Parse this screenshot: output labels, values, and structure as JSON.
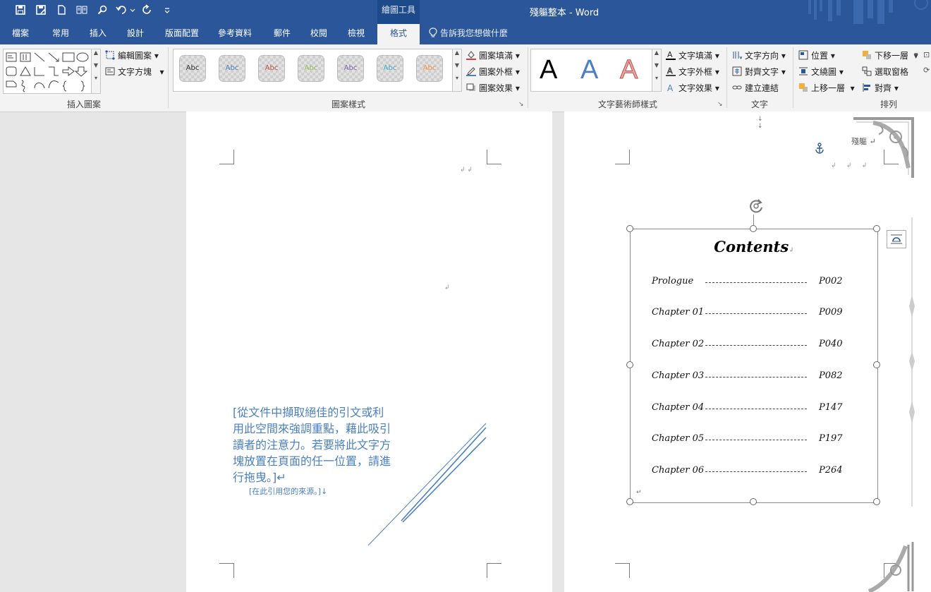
{
  "title_bar": {
    "quick_access": [
      {
        "name": "save-icon",
        "glyph": "🖫"
      },
      {
        "name": "save-as-icon",
        "glyph": "🖫"
      },
      {
        "name": "new-document-icon",
        "glyph": "🗋"
      },
      {
        "name": "read-mode-icon",
        "glyph": "▯▯"
      },
      {
        "name": "find-icon",
        "glyph": "⌕"
      },
      {
        "name": "undo-icon",
        "glyph": "↶"
      },
      {
        "name": "redo-icon",
        "glyph": "↻"
      },
      {
        "name": "customize-qat-icon",
        "glyph": "⌄"
      }
    ],
    "contextual_group": "繪圖工具",
    "document_title": "殘軀整本 - Word"
  },
  "tabs": [
    {
      "label": "檔案"
    },
    {
      "label": "常用"
    },
    {
      "label": "插入"
    },
    {
      "label": "設計"
    },
    {
      "label": "版面配置"
    },
    {
      "label": "參考資料"
    },
    {
      "label": "郵件"
    },
    {
      "label": "校閱"
    },
    {
      "label": "檢視"
    },
    {
      "label": "格式",
      "active": true
    }
  ],
  "tell_me": "告訴我您想做什麼",
  "ribbon": {
    "insert_shapes": {
      "label": "插入圖案",
      "edit_shape": "編輯圖案",
      "text_box": "文字方塊"
    },
    "shape_styles": {
      "label": "圖案樣式",
      "swatch_text": "Abc",
      "swatch_colors": [
        "#333333",
        "#4a7fc1",
        "#c0504d",
        "#9bbb59",
        "#8064a2",
        "#4bacc6",
        "#f79646"
      ],
      "fill": "圖案填滿",
      "outline": "圖案外框",
      "effects": "圖案效果"
    },
    "wordart_styles": {
      "label": "文字藝術師樣式",
      "letter": "A",
      "letter_colors": [
        "#000000",
        "#4a7fc1",
        "#e6a7a5"
      ],
      "text_fill": "文字填滿",
      "text_outline": "文字外框",
      "text_effects": "文字效果"
    },
    "text": {
      "label": "文字",
      "direction": "文字方向",
      "align": "對齊文字",
      "link": "建立連結"
    },
    "arrange": {
      "label": "排列",
      "position": "位置",
      "wrap": "文繞圖",
      "forward": "上移一層",
      "backward": "下移一層",
      "selection_pane": "選取窗格",
      "align": "對齊"
    }
  },
  "page_left": {
    "pull_quote": "[從文件中擷取絕佳的引文或利用此空間來強調重點，藉此吸引讀者的注意力。若要將此文字方塊放置在頁面的任一位置，請進行拖曳。]↵",
    "quote_source": "[在此引用您的來源。]↓"
  },
  "page_right": {
    "header_text": "殘軀",
    "contents": {
      "title": "Contents",
      "rows": [
        {
          "label": "Prologue",
          "page": "P002"
        },
        {
          "label": "Chapter 01",
          "page": "P009"
        },
        {
          "label": "Chapter 02",
          "page": "P040"
        },
        {
          "label": "Chapter 03",
          "page": "P082"
        },
        {
          "label": "Chapter 04",
          "page": "P147"
        },
        {
          "label": "Chapter 05",
          "page": "P197"
        },
        {
          "label": "Chapter 06",
          "page": "P264"
        }
      ]
    }
  }
}
